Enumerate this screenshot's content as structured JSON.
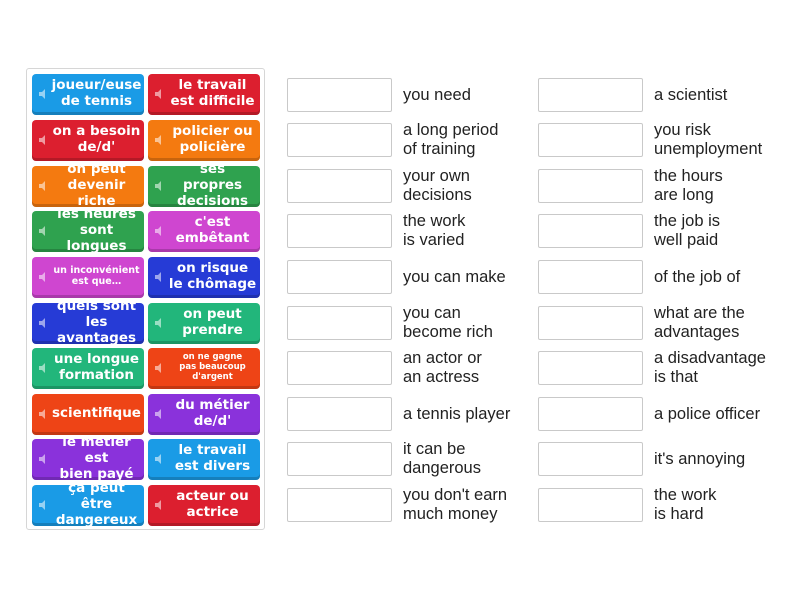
{
  "tiles": [
    {
      "text": "joueur/euse\nde tennis",
      "color": "#1a9be6"
    },
    {
      "text": "le travail\nest difficile",
      "color": "#dc1f2f"
    },
    {
      "text": "on a besoin\nde/d'",
      "color": "#dc1f2f"
    },
    {
      "text": "policier ou\npolicière",
      "color": "#f47a10"
    },
    {
      "text": "on peut\ndevenir riche",
      "color": "#f47a10"
    },
    {
      "text": "ses propres\ndecisions",
      "color": "#2fa24f"
    },
    {
      "text": "les heures\nsont longues",
      "color": "#2fa24f"
    },
    {
      "text": "c'est\nembêtant",
      "color": "#cf46d0"
    },
    {
      "text": "un inconvénient\nest que…",
      "color": "#cf46d0"
    },
    {
      "text": "on risque\nle chômage",
      "color": "#263bd6"
    },
    {
      "text": "quels sont\nles avantages",
      "color": "#263bd6"
    },
    {
      "text": "on peut\nprendre",
      "color": "#22b67b"
    },
    {
      "text": "une longue\nformation",
      "color": "#22b67b"
    },
    {
      "text": "on ne gagne\npas beaucoup\nd'argent",
      "color": "#ee4416"
    },
    {
      "text": "scientifique",
      "color": "#ee4416"
    },
    {
      "text": "du métier\nde/d'",
      "color": "#8a32db"
    },
    {
      "text": "le métier est\nbien payé",
      "color": "#8a32db"
    },
    {
      "text": "le travail\nest divers",
      "color": "#1a9be6"
    },
    {
      "text": "ça peut être\ndangereux",
      "color": "#1a9be6"
    },
    {
      "text": "acteur ou\nactrice",
      "color": "#dc1f2f"
    }
  ],
  "targets_left": [
    "you need",
    "a long period\nof training",
    "your own\ndecisions",
    "the work\nis varied",
    "you can make",
    "you can\nbecome rich",
    "an actor or\nan actress",
    "a tennis player",
    "it can be\ndangerous",
    "you don't earn\nmuch money"
  ],
  "targets_right": [
    "a scientist",
    "you risk\nunemployment",
    "the hours\nare long",
    "the job is\nwell paid",
    "of the job of",
    "what are the\nadvantages",
    "a disadvantage\nis that",
    "a police officer",
    "it's annoying",
    "the work\nis hard"
  ]
}
